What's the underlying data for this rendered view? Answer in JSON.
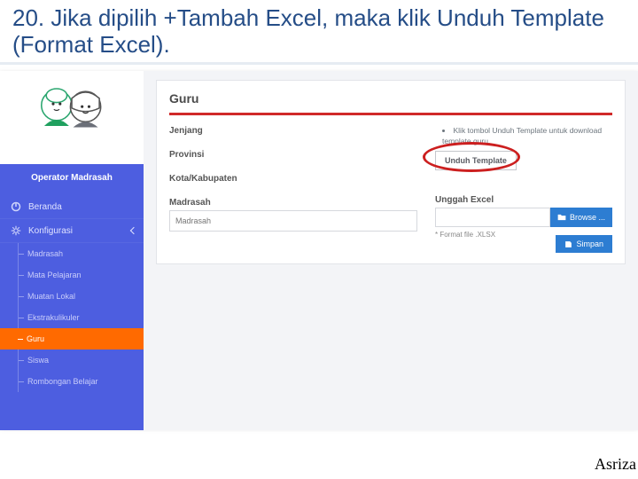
{
  "slide": {
    "title": "20. Jika dipilih +Tambah Excel, maka klik Unduh Template (Format Excel).",
    "author": "Asriza"
  },
  "sidebar": {
    "role": "Operator Madrasah",
    "menu": [
      {
        "label": "Beranda",
        "icon": "dashboard-icon"
      },
      {
        "label": "Konfigurasi",
        "icon": "gear-icon"
      }
    ],
    "submenu": [
      {
        "label": "Madrasah"
      },
      {
        "label": "Mata Pelajaran"
      },
      {
        "label": "Muatan Lokal"
      },
      {
        "label": "Ekstrakulikuler"
      },
      {
        "label": "Guru",
        "active": true
      },
      {
        "label": "Siswa"
      },
      {
        "label": "Rombongan Belajar"
      }
    ]
  },
  "panel": {
    "heading": "Guru",
    "fields": {
      "jenjang": {
        "label": "Jenjang"
      },
      "provinsi": {
        "label": "Provinsi"
      },
      "kota": {
        "label": "Kota/Kabupaten"
      },
      "madrasah": {
        "label": "Madrasah",
        "placeholder": "Madrasah"
      }
    },
    "hint": "Klik tombol Unduh Template untuk download template guru.",
    "download_label": "Unduh Template",
    "upload": {
      "label": "Unggah Excel",
      "browse": "Browse ...",
      "format": "* Format file .XLSX"
    },
    "save": "Simpan"
  }
}
